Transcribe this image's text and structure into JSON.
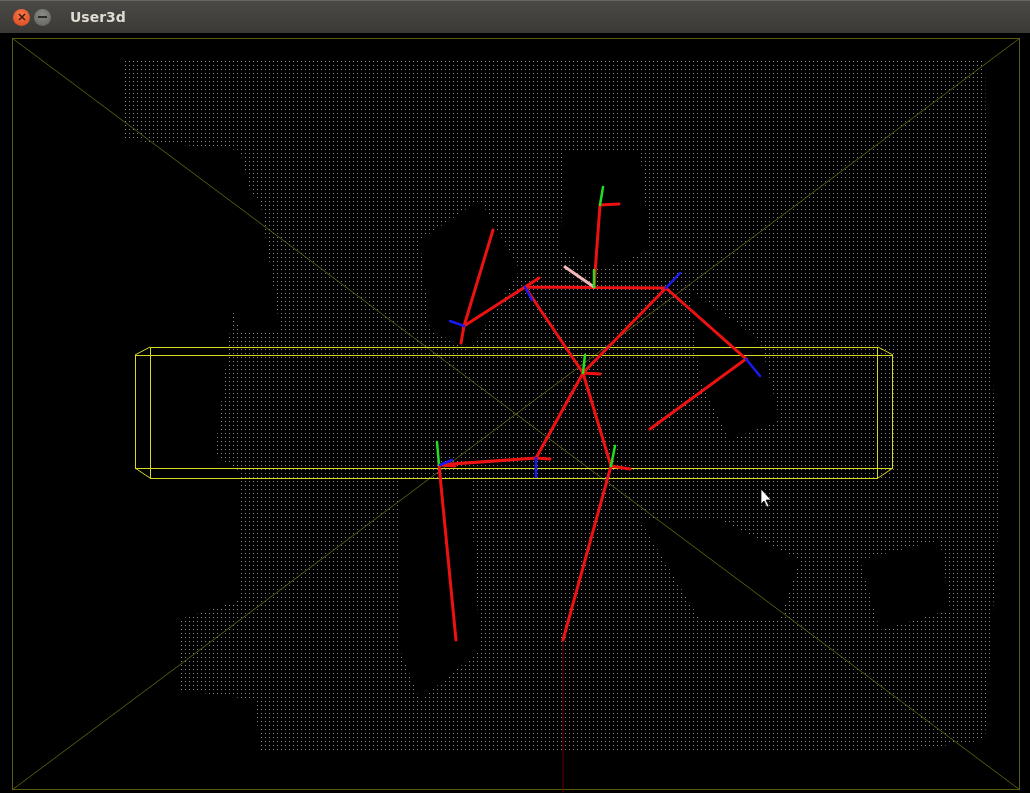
{
  "window": {
    "title": "User3d"
  }
}
